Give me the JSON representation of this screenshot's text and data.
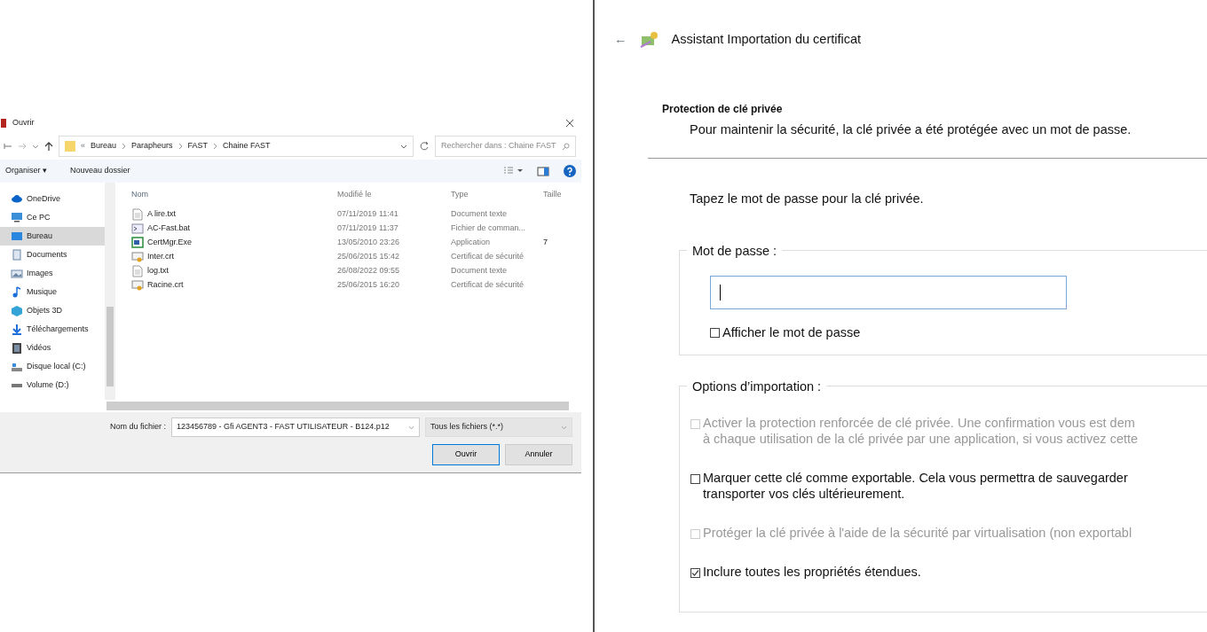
{
  "open_dialog": {
    "title": "Ouvrir",
    "breadcrumb_overflow": "«",
    "breadcrumb": [
      "Bureau",
      "Parapheurs",
      "FAST",
      "Chaine FAST"
    ],
    "search": {
      "placeholder": "Rechercher dans : Chaine FAST"
    },
    "toolbar": [
      "Organiser ▾",
      "Nouveau dossier"
    ],
    "sidebar": [
      {
        "label": "OneDrive",
        "kind": "cloud",
        "selected": false
      },
      {
        "label": "Ce PC",
        "kind": "pc",
        "selected": false
      },
      {
        "label": "Bureau",
        "kind": "desktop",
        "selected": true
      },
      {
        "label": "Documents",
        "kind": "documents",
        "selected": false
      },
      {
        "label": "Images",
        "kind": "images",
        "selected": false
      },
      {
        "label": "Musique",
        "kind": "music",
        "selected": false
      },
      {
        "label": "Objets 3D",
        "kind": "objects",
        "selected": false
      },
      {
        "label": "Téléchargements",
        "kind": "downloads",
        "selected": false
      },
      {
        "label": "Vidéos",
        "kind": "videos",
        "selected": false
      },
      {
        "label": "Disque local (C:)",
        "kind": "disk",
        "selected": false
      },
      {
        "label": "Volume (D:)",
        "kind": "volume",
        "selected": false
      }
    ],
    "columns": [
      "Nom",
      "Modifié le",
      "Type",
      "Taille"
    ],
    "files": [
      {
        "name": "A lire.txt",
        "kind": "text",
        "modified": "07/11/2019 11:41",
        "type": "Document texte"
      },
      {
        "name": "AC-Fast.bat",
        "kind": "batch",
        "modified": "07/11/2019 11:37",
        "type": "Fichier de comman..."
      },
      {
        "name": "CertMgr.Exe",
        "kind": "app",
        "modified": "13/05/2010 23:26",
        "type": "Application",
        "size": "7"
      },
      {
        "name": "Inter.crt",
        "kind": "cert",
        "modified": "25/06/2015 15:42",
        "type": "Certificat de sécurité"
      },
      {
        "name": "log.txt",
        "kind": "text",
        "modified": "26/08/2022 09:55",
        "type": "Document texte"
      },
      {
        "name": "Racine.crt",
        "kind": "cert",
        "modified": "25/06/2015 16:20",
        "type": "Certificat de sécurité"
      }
    ],
    "filename_label": "Nom du fichier :",
    "filename": "123456789 - Gfi AGENT3 - FAST UTILISATEUR - B124.p12",
    "filter": "Tous les fichiers (*.*)",
    "buttons": [
      "Ouvrir",
      "Annuler"
    ]
  },
  "wizard": {
    "back": "←",
    "title": "Assistant Importation du certificat",
    "heading": "Protection de clé privée",
    "description": "Pour maintenir la sécurité, la clé privée a été protégée avec un mot de passe.",
    "prompt": "Tapez le mot de passe pour la clé privée.",
    "password_group": "Mot de passe :",
    "show_password": {
      "label": "Afficher le mot de passe",
      "checked": false
    },
    "options_group": "Options d’importation :",
    "options": [
      {
        "text": "Activer la protection renforcée de clé privée. Une confirmation vous est dem\nà chaque utilisation de la clé privée par une application, si vous activez cette",
        "checked": false,
        "disabled": true
      },
      {
        "text": "Marquer cette clé comme exportable. Cela vous permettra de sauvegarder\ntransporter vos clés ultérieurement.",
        "checked": false,
        "disabled": false
      },
      {
        "text": "Protéger la clé privée à l'aide de la sécurité par virtualisation (non exportabl",
        "checked": false,
        "disabled": true
      },
      {
        "text": "Inclure toutes les propriétés étendues.",
        "checked": true,
        "disabled": false
      }
    ]
  }
}
